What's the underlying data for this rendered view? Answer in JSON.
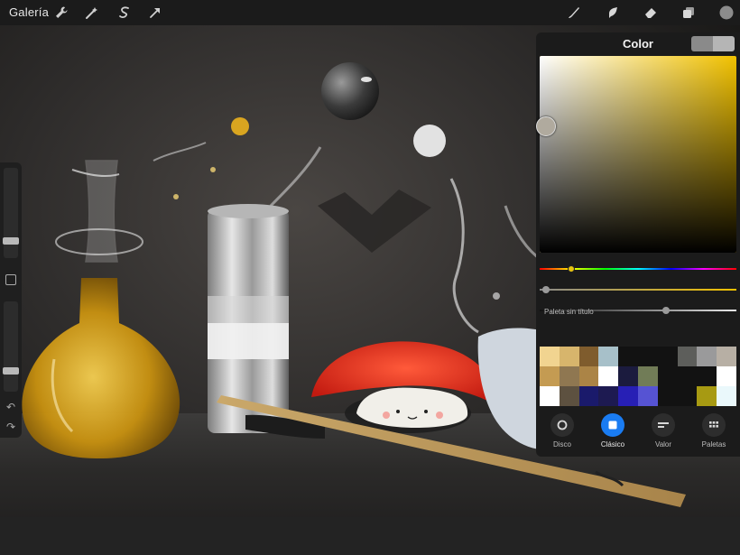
{
  "topbar": {
    "gallery_label": "Galería",
    "left_tools": [
      "wrench-icon",
      "magic-wand-icon",
      "selection-icon",
      "transform-arrow-icon"
    ],
    "right_tools": [
      "brush-icon",
      "smudge-icon",
      "eraser-icon",
      "layers-icon",
      "color-dot-icon"
    ],
    "active_color": "#8c8c8c"
  },
  "color_panel": {
    "title": "Color",
    "primary_swatch": "#8a8a8a",
    "secondary_swatch": "#b5b5b5",
    "picker_hue_color": "#f2c200",
    "sliders": {
      "hue": 0.16,
      "saturation": 0.03,
      "value": 0.64
    },
    "palette_label": "Paleta sin título",
    "palette_colors": [
      "#f1d490",
      "#d7b56c",
      "#7f5c2d",
      "#a7c0c9",
      "#121212",
      "#121212",
      "#121212",
      "#5d5e5b",
      "#9a9a9b",
      "#b7afa4",
      "#c49b52",
      "#8f7751",
      "#ab8446",
      "#ffffff",
      "#1b1b3e",
      "#717c57",
      "#121212",
      "#121212",
      "#121212",
      "#ffffff",
      "#ffffff",
      "#5d5140",
      "#1a1a6b",
      "#1d1a51",
      "#271fb5",
      "#5653d3",
      "#121212",
      "#121212",
      "#a79a12",
      "#eaf8fb"
    ],
    "tabs": [
      {
        "label": "Disco",
        "active": false
      },
      {
        "label": "Clásico",
        "active": true
      },
      {
        "label": "Valor",
        "active": false
      },
      {
        "label": "Paletas",
        "active": false
      }
    ]
  },
  "sidebar": {
    "brush_size": 0.72,
    "opacity": 0.72
  }
}
